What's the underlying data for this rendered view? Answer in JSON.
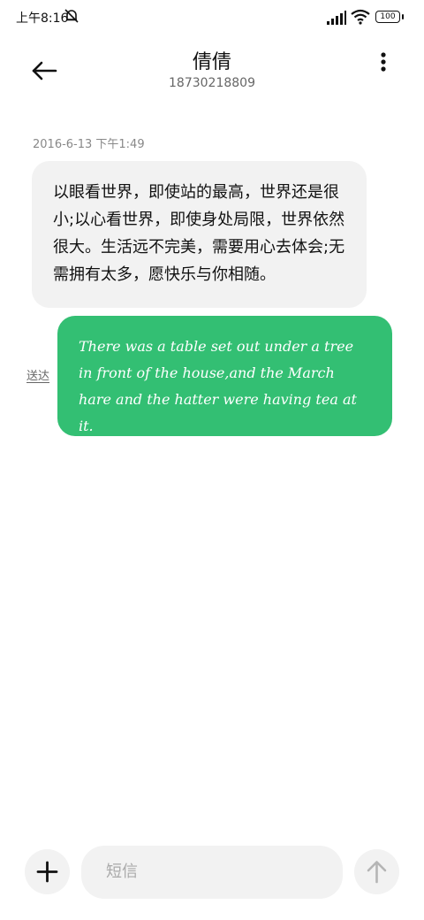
{
  "status_bar": {
    "time": "上午8:16",
    "battery": "100",
    "icons": [
      "mute-icon",
      "signal-icon",
      "wifi-icon",
      "battery-icon"
    ]
  },
  "header": {
    "contact_name": "倩倩",
    "contact_number": "18730218809",
    "icons": [
      "back-arrow-icon",
      "more-vertical-icon"
    ]
  },
  "conversation": {
    "timestamp": "2016-6-13 下午1:49",
    "incoming": {
      "text": "以眼看世界，即使站的最高，世界还是很小;以心看世界，即使身处局限，世界依然很大。生活远不完美，需要用心去体会;无需拥有太多，愿快乐与你相随。"
    },
    "outgoing": {
      "text": "There was a table set out under a tree in front of the house,and the March hare and the hatter were having tea at it.",
      "status": "送达"
    }
  },
  "composer": {
    "placeholder": "短信",
    "icons": [
      "plus-icon",
      "send-arrow-icon"
    ]
  },
  "colors": {
    "outgoing_bubble": "#33bf73",
    "incoming_bubble": "#f2f2f2",
    "background": "#ffffff"
  }
}
